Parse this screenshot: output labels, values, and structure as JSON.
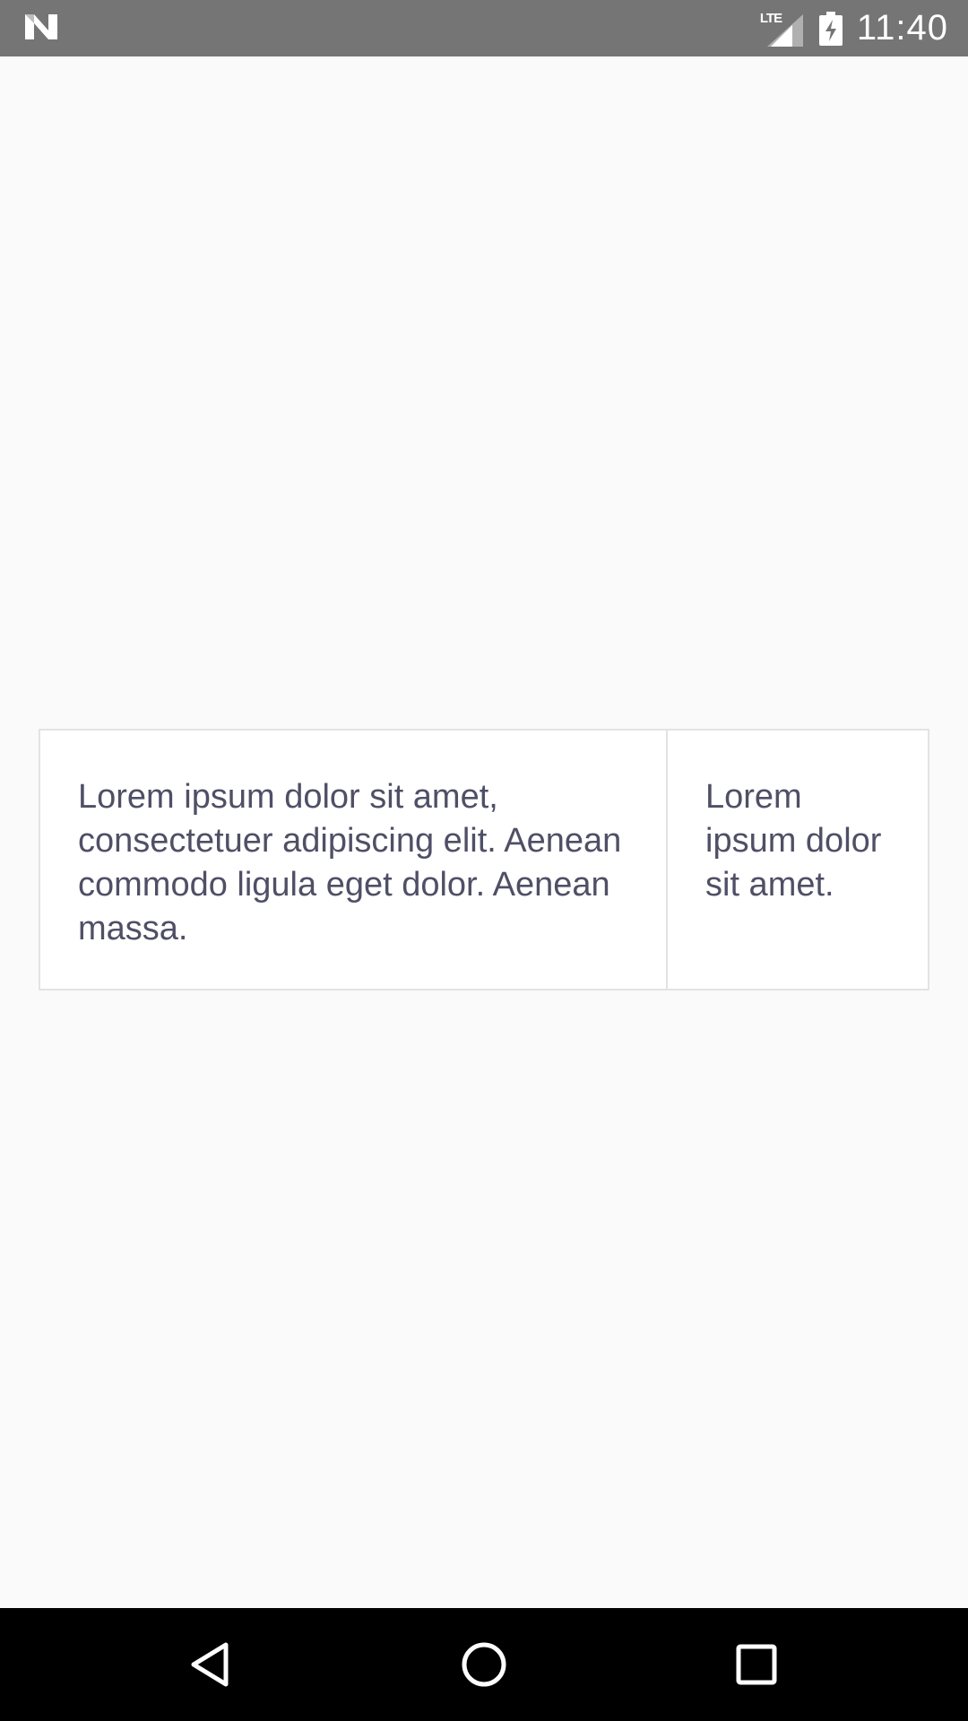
{
  "status_bar": {
    "network_label": "LTE",
    "time": "11:40",
    "left_icon": "n-logo-icon",
    "signal_icon": "signal-icon",
    "battery_icon": "battery-charging-icon"
  },
  "table": {
    "cells": [
      "Lorem ipsum dolor sit amet, consectetuer adipiscing elit. Aenean commodo ligula eget dolor. Aenean massa.",
      "Lorem ipsum dolor sit amet."
    ]
  },
  "nav_bar": {
    "back_icon": "back-triangle-icon",
    "home_icon": "home-circle-icon",
    "recents_icon": "recents-square-icon"
  },
  "colors": {
    "status_bar": "#757575",
    "background": "#fafafa",
    "table_border": "#e3e3e6",
    "text": "#4f4f66",
    "nav_bar": "#000000"
  }
}
